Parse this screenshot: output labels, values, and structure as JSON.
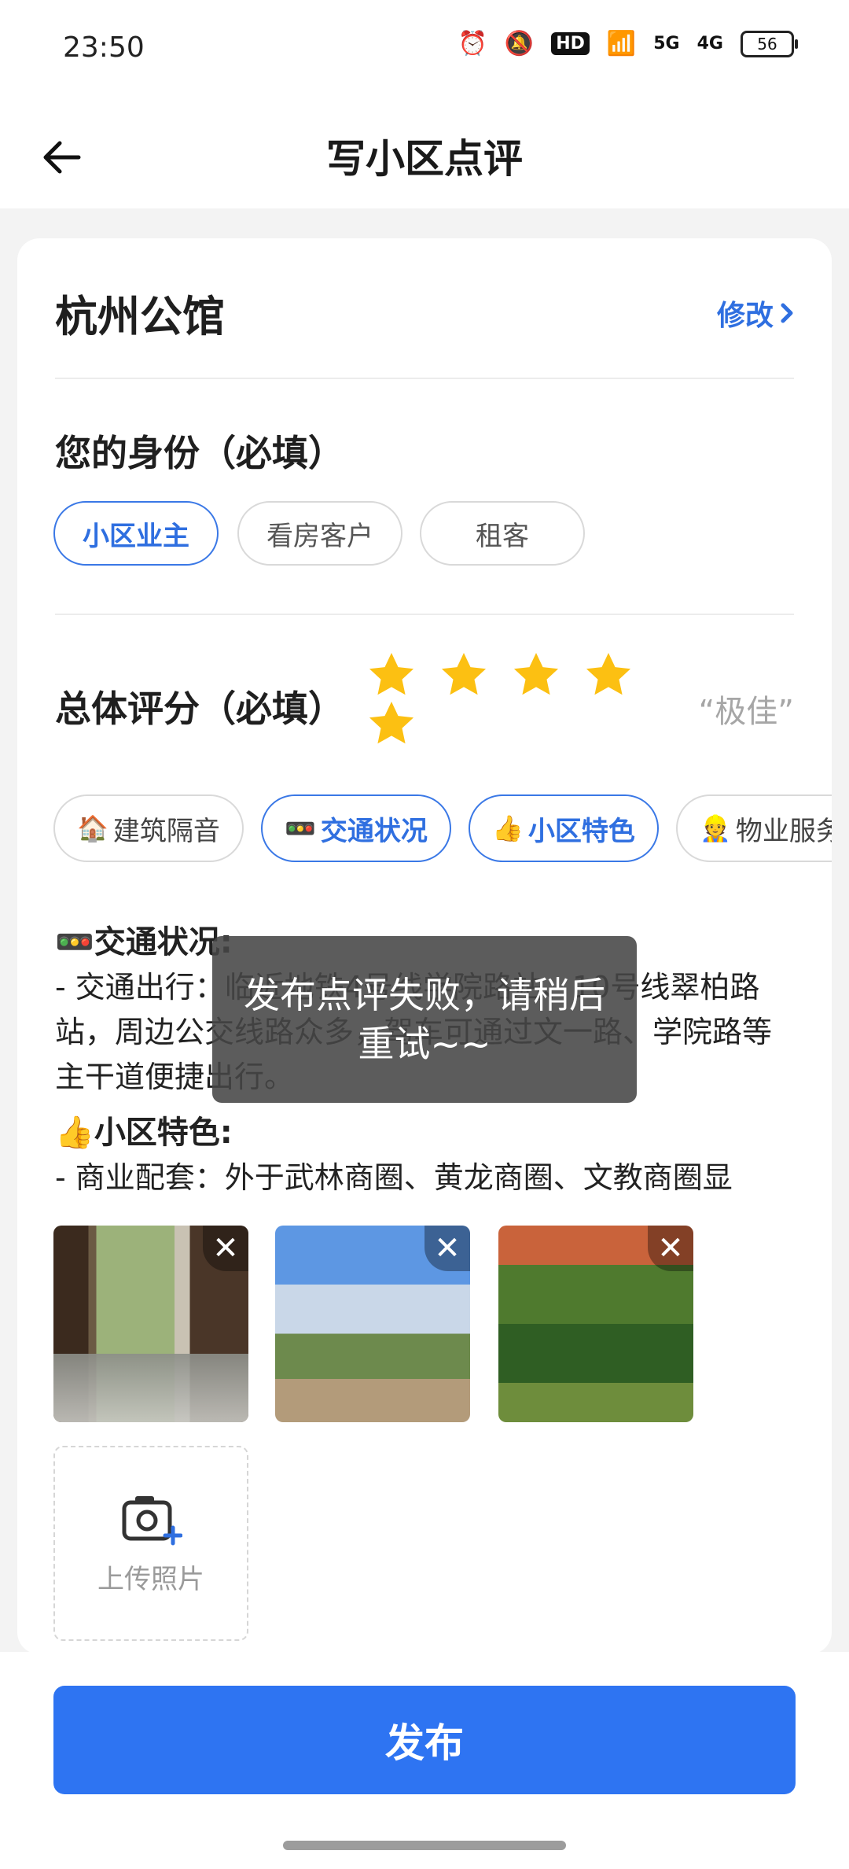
{
  "status": {
    "time": "23:50",
    "hd": "HD",
    "net1": "5G",
    "net2": "4G",
    "battery": "56"
  },
  "header": {
    "title": "写小区点评"
  },
  "community": {
    "name": "杭州公馆",
    "edit_label": "修改"
  },
  "identity": {
    "title": "您的身份（必填）",
    "options": [
      "小区业主",
      "看房客户",
      "租客"
    ],
    "selected": "小区业主"
  },
  "rating": {
    "title": "总体评分（必填）",
    "stars": 5,
    "label": "“极佳”"
  },
  "categories": [
    {
      "emoji": "🏠",
      "label": "建筑隔音",
      "selected": false
    },
    {
      "emoji": "🚥",
      "label": "交通状况",
      "selected": true
    },
    {
      "emoji": "👍",
      "label": "小区特色",
      "selected": true
    },
    {
      "emoji": "👷",
      "label": "物业服务",
      "selected": false
    }
  ],
  "review": {
    "section1_title": "交通状况:",
    "section1_body": "- 交通出行：临近地铁4号线学院路站、10号线翠柏路站，周边公交线路众多，驾车可通过文一路、学院路等主干道便捷出行。",
    "section2_title": "小区特色:",
    "section2_body": "- 商业配套：外于武林商圈、黄龙商圈、文教商圈显"
  },
  "toast": {
    "message": "发布点评失败，请稍后重试~~"
  },
  "photos": {
    "upload_label": "上传照片"
  },
  "footer": {
    "publish_label": "发布"
  }
}
